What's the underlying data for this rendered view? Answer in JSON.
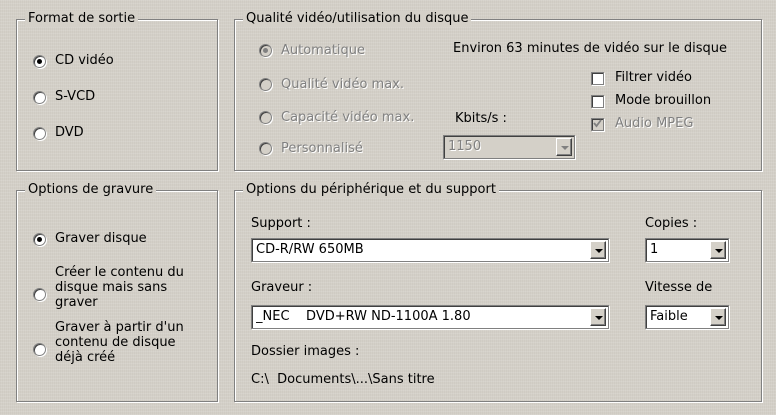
{
  "output_format": {
    "title": "Format de sortie",
    "options": [
      {
        "label": "CD vidéo",
        "selected": true
      },
      {
        "label": "S-VCD",
        "selected": false
      },
      {
        "label": "DVD",
        "selected": false
      }
    ]
  },
  "quality": {
    "title": "Qualité vidéo/utilisation du disque",
    "options": [
      {
        "label": "Automatique",
        "selected": true,
        "disabled": true
      },
      {
        "label": "Qualité vidéo max.",
        "selected": false,
        "disabled": true
      },
      {
        "label": "Capacité vidéo max.",
        "selected": false,
        "disabled": true
      },
      {
        "label": "Personnalisé",
        "selected": false,
        "disabled": true
      }
    ],
    "estimate_text": "Environ 63 minutes de vidéo sur le disque",
    "kbits_label": "Kbits/s :",
    "kbits_value": "1150",
    "checkboxes": [
      {
        "label": "Filtrer vidéo",
        "checked": false,
        "disabled": false
      },
      {
        "label": "Mode brouillon",
        "checked": false,
        "disabled": false
      },
      {
        "label": "Audio MPEG",
        "checked": true,
        "disabled": true
      }
    ]
  },
  "burn_options": {
    "title": "Options de gravure",
    "options": [
      {
        "label": "Graver disque",
        "selected": true
      },
      {
        "label": "Créer le contenu du disque mais sans graver",
        "selected": false
      },
      {
        "label": "Graver à partir d'un contenu de disque déjà créé",
        "selected": false
      }
    ]
  },
  "device": {
    "title": "Options du périphérique et du support",
    "support_label": "Support :",
    "support_value": "CD-R/RW 650MB",
    "copies_label": "Copies :",
    "copies_value": "1",
    "burner_label": "Graveur :",
    "burner_value": "_NEC    DVD+RW ND-1100A 1.80",
    "speed_label": "Vitesse de",
    "speed_value": "Faible",
    "images_folder_label": "Dossier images :",
    "images_folder_path": "C:\\  Documents\\...\\Sans titre"
  },
  "colors": {
    "face": "#d4d0c8",
    "shadow": "#808080",
    "highlight": "#ffffff",
    "disabled_text": "#808080"
  }
}
